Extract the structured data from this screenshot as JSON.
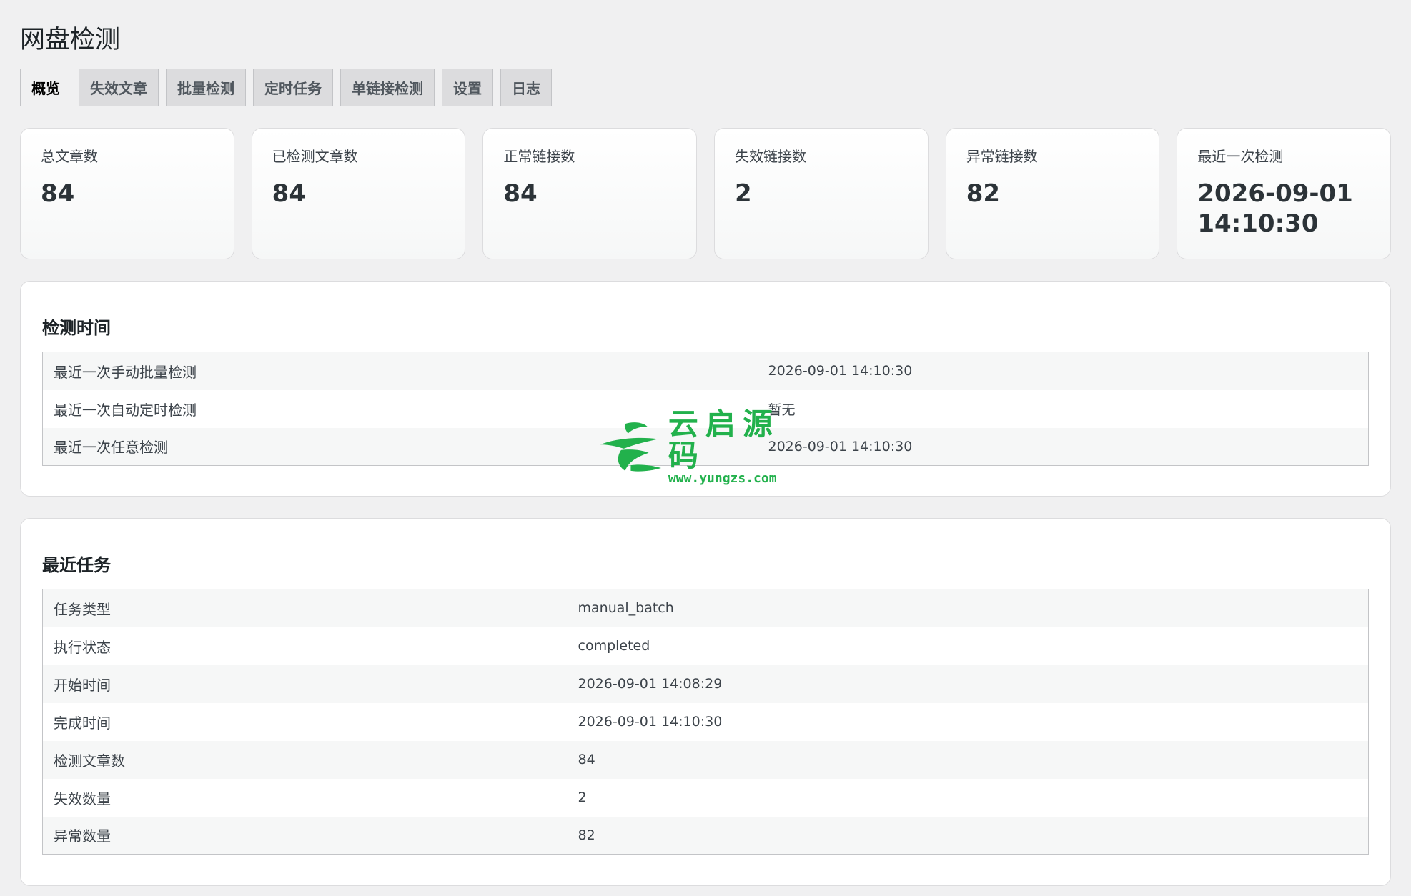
{
  "page": {
    "title": "网盘检测"
  },
  "tabs": [
    {
      "label": "概览",
      "active": true
    },
    {
      "label": "失效文章",
      "active": false
    },
    {
      "label": "批量检测",
      "active": false
    },
    {
      "label": "定时任务",
      "active": false
    },
    {
      "label": "单链接检测",
      "active": false
    },
    {
      "label": "设置",
      "active": false
    },
    {
      "label": "日志",
      "active": false
    }
  ],
  "stats": [
    {
      "label": "总文章数",
      "value": "84"
    },
    {
      "label": "已检测文章数",
      "value": "84"
    },
    {
      "label": "正常链接数",
      "value": "84"
    },
    {
      "label": "失效链接数",
      "value": "2"
    },
    {
      "label": "异常链接数",
      "value": "82"
    },
    {
      "label": "最近一次检测",
      "value": "2026-09-01 14:10:30"
    }
  ],
  "detect_time": {
    "title": "检测时间",
    "rows": [
      {
        "key": "最近一次手动批量检测",
        "value": "2026-09-01 14:10:30"
      },
      {
        "key": "最近一次自动定时检测",
        "value": "暂无"
      },
      {
        "key": "最近一次任意检测",
        "value": "2026-09-01 14:10:30"
      }
    ]
  },
  "recent_task": {
    "title": "最近任务",
    "rows": [
      {
        "key": "任务类型",
        "value": "manual_batch"
      },
      {
        "key": "执行状态",
        "value": "completed"
      },
      {
        "key": "开始时间",
        "value": "2026-09-01 14:08:29"
      },
      {
        "key": "完成时间",
        "value": "2026-09-01 14:10:30"
      },
      {
        "key": "检测文章数",
        "value": "84"
      },
      {
        "key": "失效数量",
        "value": "2"
      },
      {
        "key": "异常数量",
        "value": "82"
      }
    ]
  },
  "watermark": {
    "name": "云启源码",
    "url": "www.yungzs.com",
    "color": "#22b14c"
  },
  "colors": {
    "background": "#f0f0f1",
    "tab_inactive": "#dcdcde",
    "border": "#c3c4c7"
  }
}
